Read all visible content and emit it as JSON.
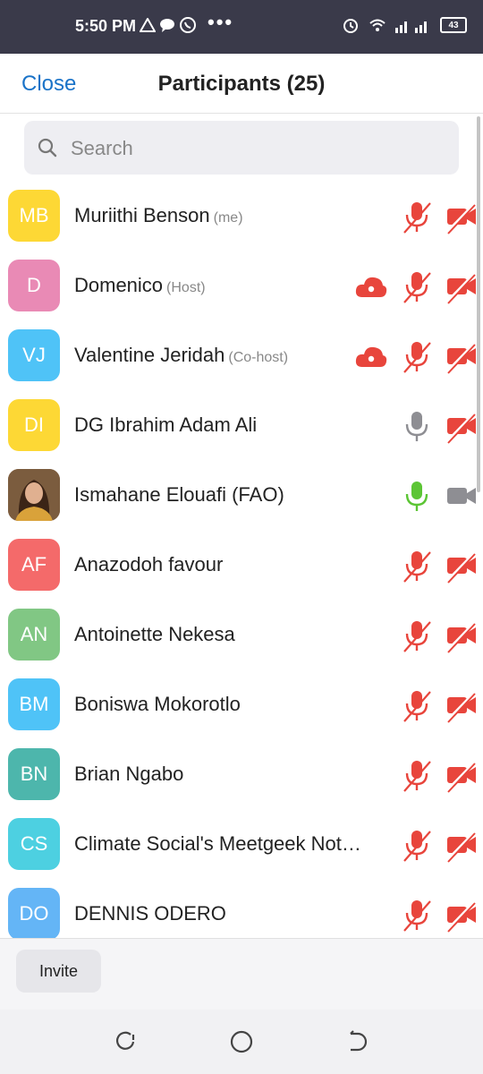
{
  "status_bar": {
    "time": "5:50 PM",
    "battery": "43",
    "icons": [
      "triangle-icon",
      "chat-icon",
      "whatsapp-icon",
      "more-dots-icon",
      "alarm-icon",
      "wifi-icon",
      "signal-icon",
      "battery-icon"
    ]
  },
  "header": {
    "close_label": "Close",
    "title": "Participants (25)"
  },
  "search": {
    "placeholder": "Search"
  },
  "colors": {
    "accent": "#1a73c8",
    "muted_red": "#e8453c",
    "grey": "#8e8e93",
    "green": "#5cc535"
  },
  "participants": [
    {
      "initials": "MB",
      "name": "Muriithi Benson",
      "tag": "(me)",
      "avatar_color": "#fdd835",
      "cloud": false,
      "mic": "muted",
      "video": "off"
    },
    {
      "initials": "D",
      "name": "Domenico",
      "tag": "(Host)",
      "avatar_color": "#e98ab5",
      "cloud": true,
      "mic": "muted",
      "video": "off"
    },
    {
      "initials": "VJ",
      "name": "Valentine Jeridah",
      "tag": "(Co-host)",
      "avatar_color": "#4fc3f7",
      "cloud": true,
      "mic": "muted",
      "video": "off"
    },
    {
      "initials": "DI",
      "name": "DG Ibrahim Adam Ali",
      "tag": "",
      "avatar_color": "#fdd835",
      "cloud": false,
      "mic": "grey",
      "video": "off"
    },
    {
      "initials": "",
      "name": "Ismahane Elouafi (FAO)",
      "tag": "",
      "avatar_color": "#8a5a3a",
      "photo": true,
      "cloud": false,
      "mic": "green",
      "video": "grey"
    },
    {
      "initials": "AF",
      "name": "Anazodoh favour",
      "tag": "",
      "avatar_color": "#f46a6a",
      "cloud": false,
      "mic": "muted",
      "video": "off"
    },
    {
      "initials": "AN",
      "name": "Antoinette Nekesa",
      "tag": "",
      "avatar_color": "#81c784",
      "cloud": false,
      "mic": "muted",
      "video": "off"
    },
    {
      "initials": "BM",
      "name": "Boniswa Mokorotlo",
      "tag": "",
      "avatar_color": "#4fc3f7",
      "cloud": false,
      "mic": "muted",
      "video": "off"
    },
    {
      "initials": "BN",
      "name": "Brian Ngabo",
      "tag": "",
      "avatar_color": "#4db6ac",
      "cloud": false,
      "mic": "muted",
      "video": "off"
    },
    {
      "initials": "CS",
      "name": "Climate Social's Meetgeek Not…",
      "tag": "",
      "avatar_color": "#4dd0e1",
      "cloud": false,
      "mic": "muted",
      "video": "off"
    },
    {
      "initials": "DO",
      "name": "DENNIS ODERO",
      "tag": "",
      "avatar_color": "#64b5f6",
      "cloud": false,
      "mic": "muted",
      "video": "off"
    }
  ],
  "footer": {
    "invite_label": "Invite"
  },
  "nav": [
    "recent-apps-icon",
    "home-icon",
    "back-icon"
  ]
}
